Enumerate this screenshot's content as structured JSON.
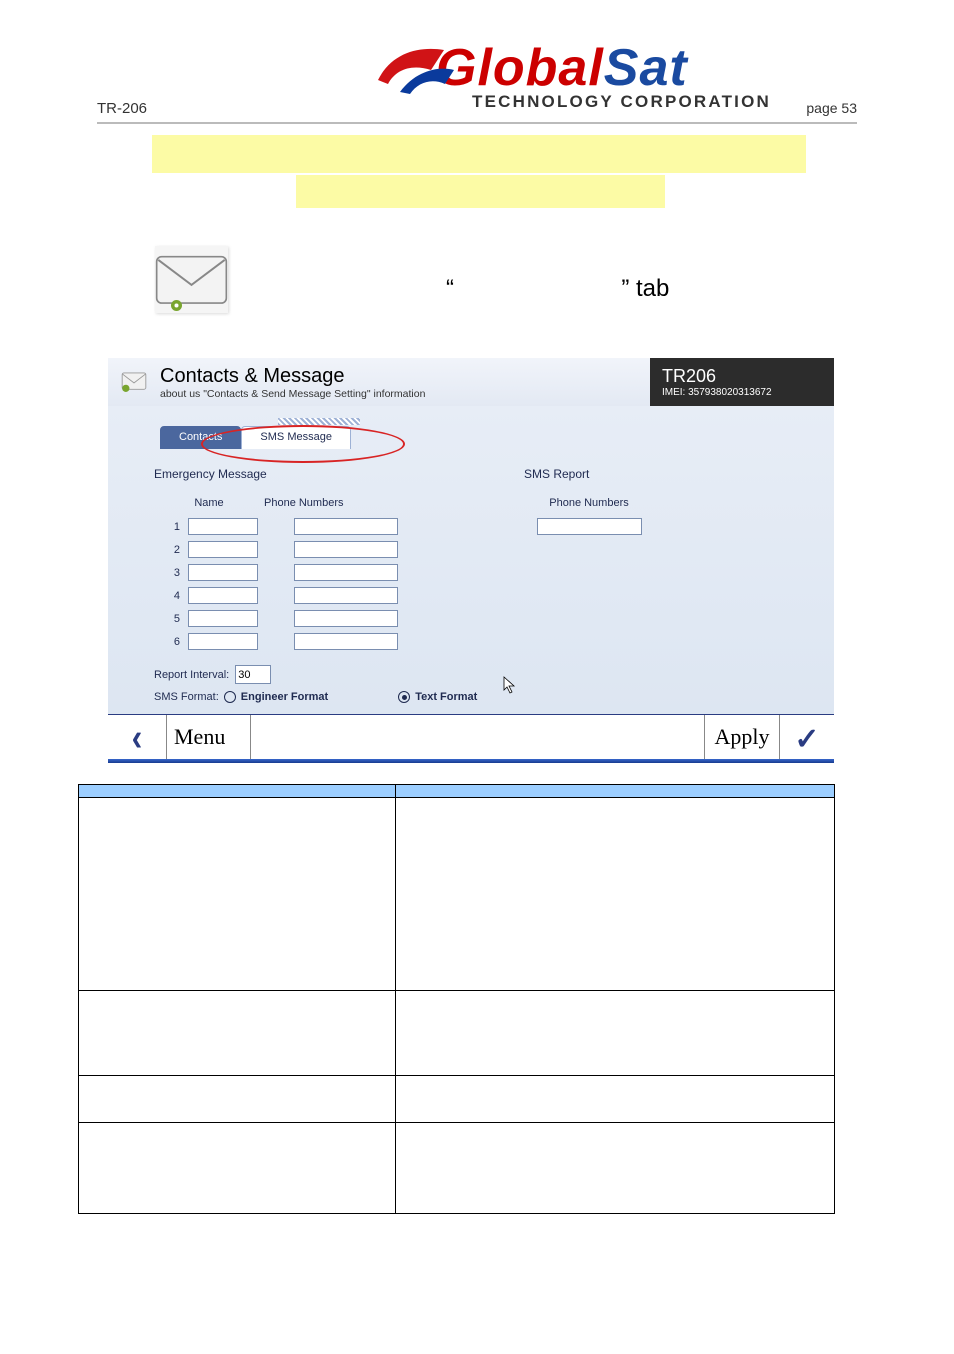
{
  "header": {
    "model": "TR-206",
    "page_label": "page 53",
    "brand_left": "Global",
    "brand_right": "Sat",
    "brand_sub": "TECHNOLOGY CORPORATION"
  },
  "tab_hint": {
    "open_quote": "“",
    "close_quote_and_word": "” tab"
  },
  "screenshot": {
    "title": "Contacts & Message",
    "subtitle": "about us \"Contacts & Send Message Setting\" information",
    "device_name": "TR206",
    "imei_label": "IMEI: 357938020313672",
    "tabs": {
      "contacts_label": "Contacts",
      "sms_label": "SMS Message"
    },
    "left_section_title": "Emergency Message",
    "columns": {
      "name_header": "Name",
      "phone_header": "Phone Numbers"
    },
    "rows": [
      "1",
      "2",
      "3",
      "4",
      "5",
      "6"
    ],
    "report_interval_label": "Report Interval:",
    "report_interval_value": "30",
    "sms_format_label": "SMS Format:",
    "engineer_label": "Engineer Format",
    "text_format_label": "Text Format",
    "right_section_title": "SMS Report",
    "right_column_header": "Phone Numbers",
    "footer": {
      "menu_label": "Menu",
      "apply_label": "Apply"
    }
  },
  "table": {
    "header_left": "",
    "header_right": ""
  }
}
